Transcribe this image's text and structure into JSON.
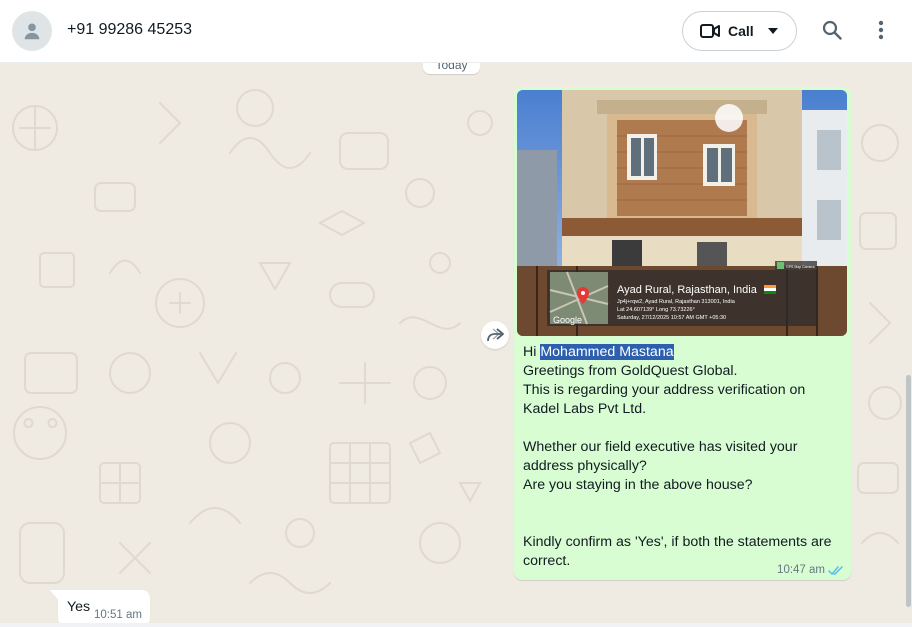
{
  "header": {
    "contact_name": "+91 99286 45253",
    "call_label": "Call",
    "icons": [
      "person-icon",
      "video-camera-icon",
      "chevron-down-icon",
      "search-icon",
      "more-vert-icon"
    ]
  },
  "chat": {
    "day_divider": "Today",
    "outgoing": {
      "photo_overlay": {
        "location_title": "Ayad Rural, Rajasthan, India",
        "flag_icon": "india-flag-icon",
        "address_line": "Jp4j+rqw2, Ayad Rural, Rajasthan 313001, India",
        "coords_line": "Lat 24.607139° Long 73.73226°",
        "timestamp_line": "Saturday, 27/12/2025 10:57 AM GMT +05:30",
        "map_brand": "Google",
        "app_badge": "GPS Map Camera"
      },
      "greeting_prefix": "Hi ",
      "highlighted_name": "Mohammed Mastana",
      "body": "Greetings from GoldQuest Global.\nThis is regarding your address verification on Kadel Labs Pvt Ltd.\n\nWhether our field executive has visited your address physically?\nAre you staying in the above house?\n\n\nKindly confirm as 'Yes', if both the statements are correct.",
      "time": "10:47 am",
      "status_icon": "double-check-icon",
      "status_color": "#53bdeb"
    },
    "incoming": {
      "text": "Yes",
      "time": "10:51 am"
    }
  },
  "colors": {
    "chat_background": "#efeae2",
    "outgoing_bubble": "#d9fdd3",
    "incoming_bubble": "#ffffff",
    "highlight": "#2c5fad"
  }
}
